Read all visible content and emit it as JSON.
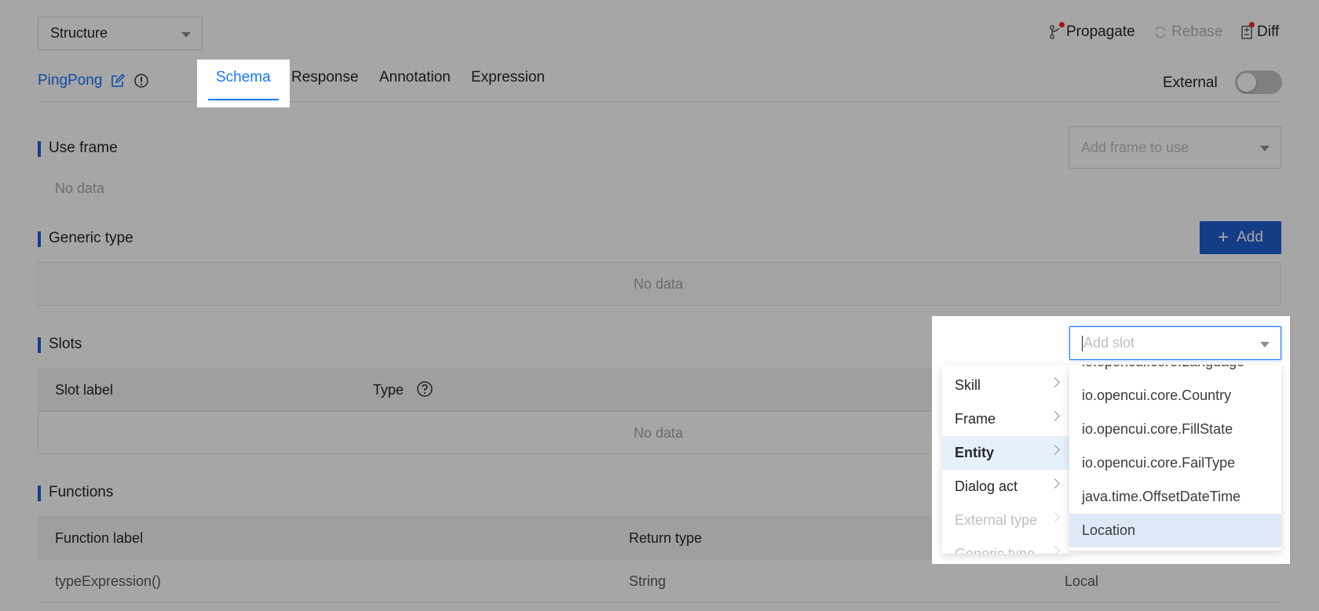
{
  "top": {
    "structure_select": "Structure",
    "toolbar": {
      "propagate": "Propagate",
      "rebase": "Rebase",
      "diff": "Diff"
    }
  },
  "header": {
    "title": "PingPong",
    "external_label": "External",
    "external_on": false
  },
  "tabs": [
    {
      "label": "Schema",
      "active": true
    },
    {
      "label": "Response",
      "active": false
    },
    {
      "label": "Annotation",
      "active": false
    },
    {
      "label": "Expression",
      "active": false
    }
  ],
  "use_frame": {
    "title": "Use frame",
    "placeholder": "Add frame to use",
    "empty": "No data"
  },
  "generic_type": {
    "title": "Generic type",
    "add_button": "Add",
    "empty": "No data"
  },
  "slots": {
    "title": "Slots",
    "search_placeholder": "Add slot",
    "columns": [
      "Slot label",
      "Type"
    ],
    "empty": "No data"
  },
  "functions": {
    "title": "Functions",
    "columns": [
      "Function label",
      "Return type"
    ],
    "rows": [
      {
        "label": "typeExpression()",
        "return_type": "String",
        "scope": "Local"
      }
    ]
  },
  "cascader": {
    "level1": [
      {
        "label": "Skill",
        "state": "normal"
      },
      {
        "label": "Frame",
        "state": "normal"
      },
      {
        "label": "Entity",
        "state": "active"
      },
      {
        "label": "Dialog act",
        "state": "normal"
      },
      {
        "label": "External type",
        "state": "disabled"
      },
      {
        "label": "Generic type",
        "state": "disabled"
      }
    ],
    "level2": [
      {
        "label": "io.opencui.core.Language",
        "selected": false
      },
      {
        "label": "io.opencui.core.Country",
        "selected": false
      },
      {
        "label": "io.opencui.core.FillState",
        "selected": false
      },
      {
        "label": "io.opencui.core.FailType",
        "selected": false
      },
      {
        "label": "java.time.OffsetDateTime",
        "selected": false
      },
      {
        "label": "Location",
        "selected": true
      }
    ]
  },
  "colors": {
    "accent": "#1677ff",
    "primary_button": "#1f5ecf",
    "badge": "#f5222d"
  }
}
